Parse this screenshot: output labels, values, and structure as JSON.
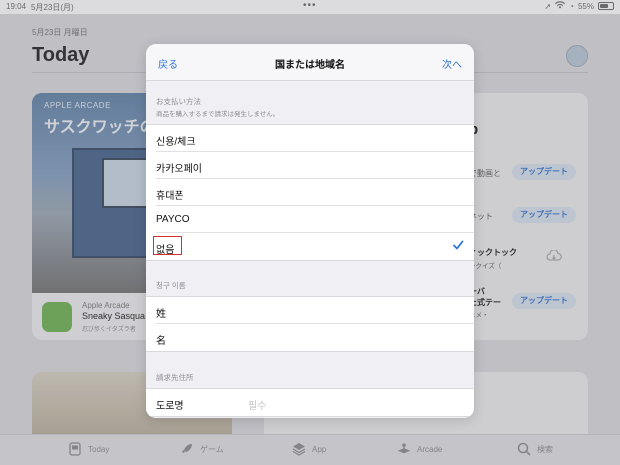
{
  "status_bar": {
    "time": "19:04",
    "date": "5月23日(月)",
    "battery": "55%",
    "battery_level": 0.55
  },
  "background": {
    "date_label": "5月23日 月曜日",
    "page_title": "Today",
    "card1": {
      "kicker": "APPLE ARCADE",
      "headline": "サスクワッチの",
      "app_kicker": "Apple Arcade",
      "app_name": "Sneaky Sasqua",
      "app_sub": "忍び歩くイタズラ者"
    },
    "card2": {
      "big_letter": "p",
      "fragments": [
        "で動画と",
        "ネット",
        "ィックトック",
        "ークイズ（",
        "ーバ",
        "た式テー",
        "ニメ・"
      ],
      "update_label": "アップデート"
    }
  },
  "tab_bar": {
    "items": [
      {
        "label": "Today",
        "icon": "today-icon"
      },
      {
        "label": "ゲーム",
        "icon": "rocket-icon"
      },
      {
        "label": "App",
        "icon": "layers-icon"
      },
      {
        "label": "Arcade",
        "icon": "arcade-icon"
      },
      {
        "label": "検索",
        "icon": "search-icon"
      }
    ]
  },
  "modal": {
    "back_label": "戻る",
    "title": "国または地域名",
    "next_label": "次へ",
    "payment_section": {
      "label": "お支払い方法",
      "note": "商品を購入するまで請求は発生しません。",
      "options": [
        {
          "label": "신용/체크",
          "selected": false
        },
        {
          "label": "카카오페이",
          "selected": false
        },
        {
          "label": "휴대폰",
          "selected": false
        },
        {
          "label": "PAYCO",
          "selected": false
        },
        {
          "label": "없음",
          "selected": true
        }
      ]
    },
    "billing_name_section": {
      "label": "청구 이름",
      "fields": [
        {
          "label": "姓"
        },
        {
          "label": "名"
        }
      ]
    },
    "billing_address_section": {
      "label": "請求先住所",
      "fields": [
        {
          "label": "도로명",
          "placeholder": "필수"
        }
      ]
    }
  },
  "colors": {
    "accent": "#2e74d8",
    "highlight": "#d32f2f"
  }
}
